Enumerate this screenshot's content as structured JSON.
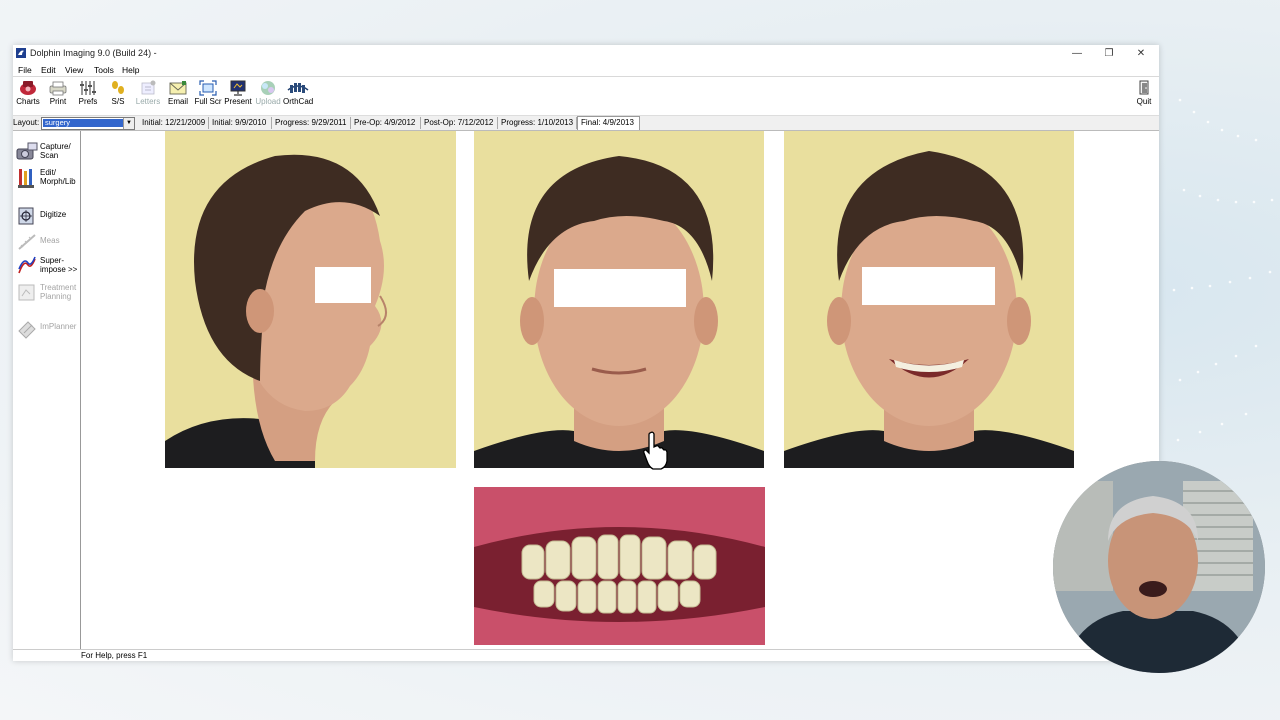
{
  "window": {
    "title": "Dolphin Imaging 9.0 (Build 24) -",
    "controls": {
      "minimize": "—",
      "restore": "❐",
      "close": "✕"
    }
  },
  "menu": [
    "File",
    "Edit",
    "View",
    "Tools",
    "Help"
  ],
  "toolbar": {
    "items": [
      {
        "label": "Charts",
        "icon": "charts-icon",
        "enabled": true
      },
      {
        "label": "Print",
        "icon": "printer-icon",
        "enabled": true
      },
      {
        "label": "Prefs",
        "icon": "sliders-icon",
        "enabled": true
      },
      {
        "label": "S/S",
        "icon": "footprints-icon",
        "enabled": true
      },
      {
        "label": "Letters",
        "icon": "letters-icon",
        "enabled": false
      },
      {
        "label": "Email",
        "icon": "envelope-icon",
        "enabled": true
      },
      {
        "label": "Full Scr",
        "icon": "fullscreen-icon",
        "enabled": true
      },
      {
        "label": "Present",
        "icon": "monitor-icon",
        "enabled": true
      },
      {
        "label": "Upload",
        "icon": "upload-icon",
        "enabled": false
      },
      {
        "label": "OrthCad",
        "icon": "orthcad-icon",
        "enabled": true
      }
    ],
    "quit_label": "Quit"
  },
  "layoutbar": {
    "label": "Layout:",
    "selected": "surgery",
    "tabs": [
      {
        "label": "Initial: 12/21/2009",
        "active": false
      },
      {
        "label": "Initial: 9/9/2010",
        "active": false
      },
      {
        "label": "Progress: 9/29/2011",
        "active": false
      },
      {
        "label": "Pre-Op: 4/9/2012",
        "active": false
      },
      {
        "label": "Post-Op: 7/12/2012",
        "active": false
      },
      {
        "label": "Progress: 1/10/2013",
        "active": false
      },
      {
        "label": "Final: 4/9/2013",
        "active": true
      }
    ]
  },
  "sidebar": {
    "items": [
      {
        "label1": "Capture/",
        "label2": "Scan",
        "icon": "camera-scan-icon",
        "enabled": true
      },
      {
        "label1": "Edit/",
        "label2": "Morph/Lib",
        "icon": "paintbrush-icon",
        "enabled": true
      },
      {
        "label1": "Digitize",
        "label2": "",
        "icon": "digitize-icon",
        "enabled": true
      },
      {
        "label1": "Meas",
        "label2": "",
        "icon": "measure-icon",
        "enabled": false
      },
      {
        "label1": "Super-",
        "label2": "impose >>",
        "icon": "superimpose-icon",
        "enabled": true
      },
      {
        "label1": "Treatment",
        "label2": "Planning",
        "icon": "treatment-icon",
        "enabled": false
      },
      {
        "label1": "ImPlanner",
        "label2": "",
        "icon": "implanner-icon",
        "enabled": false
      }
    ]
  },
  "photos": [
    {
      "view": "profile",
      "icon": "face-profile-photo"
    },
    {
      "view": "frontal-rest",
      "icon": "face-frontal-photo"
    },
    {
      "view": "frontal-smile",
      "icon": "face-smile-photo"
    },
    {
      "view": "intraoral",
      "icon": "teeth-photo"
    }
  ],
  "status": {
    "text": "For Help, press F1"
  },
  "colors": {
    "photo_bg": "#e9df9e",
    "skin": "#d9a888",
    "hair": "#3e2c22",
    "shirt": "#1d1d1f",
    "gum": "#c9506a",
    "selection": "#3366cc"
  }
}
